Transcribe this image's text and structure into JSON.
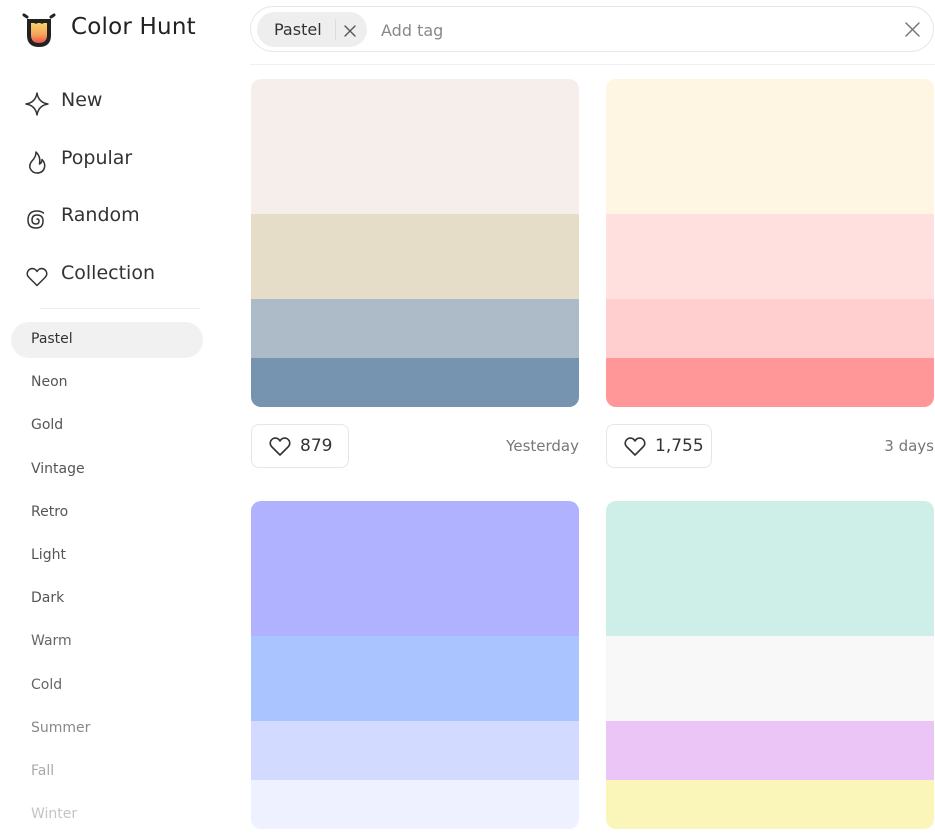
{
  "app": {
    "brand": "Color Hunt"
  },
  "search": {
    "chip_label": "Pastel",
    "placeholder": "Add tag"
  },
  "nav": [
    {
      "label": "New",
      "icon": "sparkle-icon"
    },
    {
      "label": "Popular",
      "icon": "flame-icon"
    },
    {
      "label": "Random",
      "icon": "spiral-icon"
    },
    {
      "label": "Collection",
      "icon": "heart-icon"
    }
  ],
  "tags": [
    {
      "label": "Pastel",
      "active": true,
      "color": "#333333"
    },
    {
      "label": "Neon",
      "color": "#555555"
    },
    {
      "label": "Gold",
      "color": "#555555"
    },
    {
      "label": "Vintage",
      "color": "#555555"
    },
    {
      "label": "Retro",
      "color": "#555555"
    },
    {
      "label": "Light",
      "color": "#555555"
    },
    {
      "label": "Dark",
      "color": "#555555"
    },
    {
      "label": "Warm",
      "color": "#666666"
    },
    {
      "label": "Cold",
      "color": "#666666"
    },
    {
      "label": "Summer",
      "color": "#888888"
    },
    {
      "label": "Fall",
      "color": "#a8a8a8"
    },
    {
      "label": "Winter",
      "color": "#c4c4c4"
    }
  ],
  "palettes": [
    {
      "colors": [
        "#F5EEEA",
        "#E6DDC8",
        "#ADBAC7",
        "#7693B0"
      ],
      "likes": "879",
      "date": "Yesterday"
    },
    {
      "colors": [
        "#FEF5E2",
        "#FFE0DF",
        "#FFCFCF",
        "#FF9697"
      ],
      "likes": "1,755",
      "date": "3 days"
    },
    {
      "colors": [
        "#B1B2FF",
        "#AAC4FF",
        "#D2DAFF",
        "#EEF1FF"
      ]
    },
    {
      "colors": [
        "#CDEFE8",
        "#F8F8F8",
        "#EAC5F6",
        "#FAF5B8"
      ]
    }
  ]
}
